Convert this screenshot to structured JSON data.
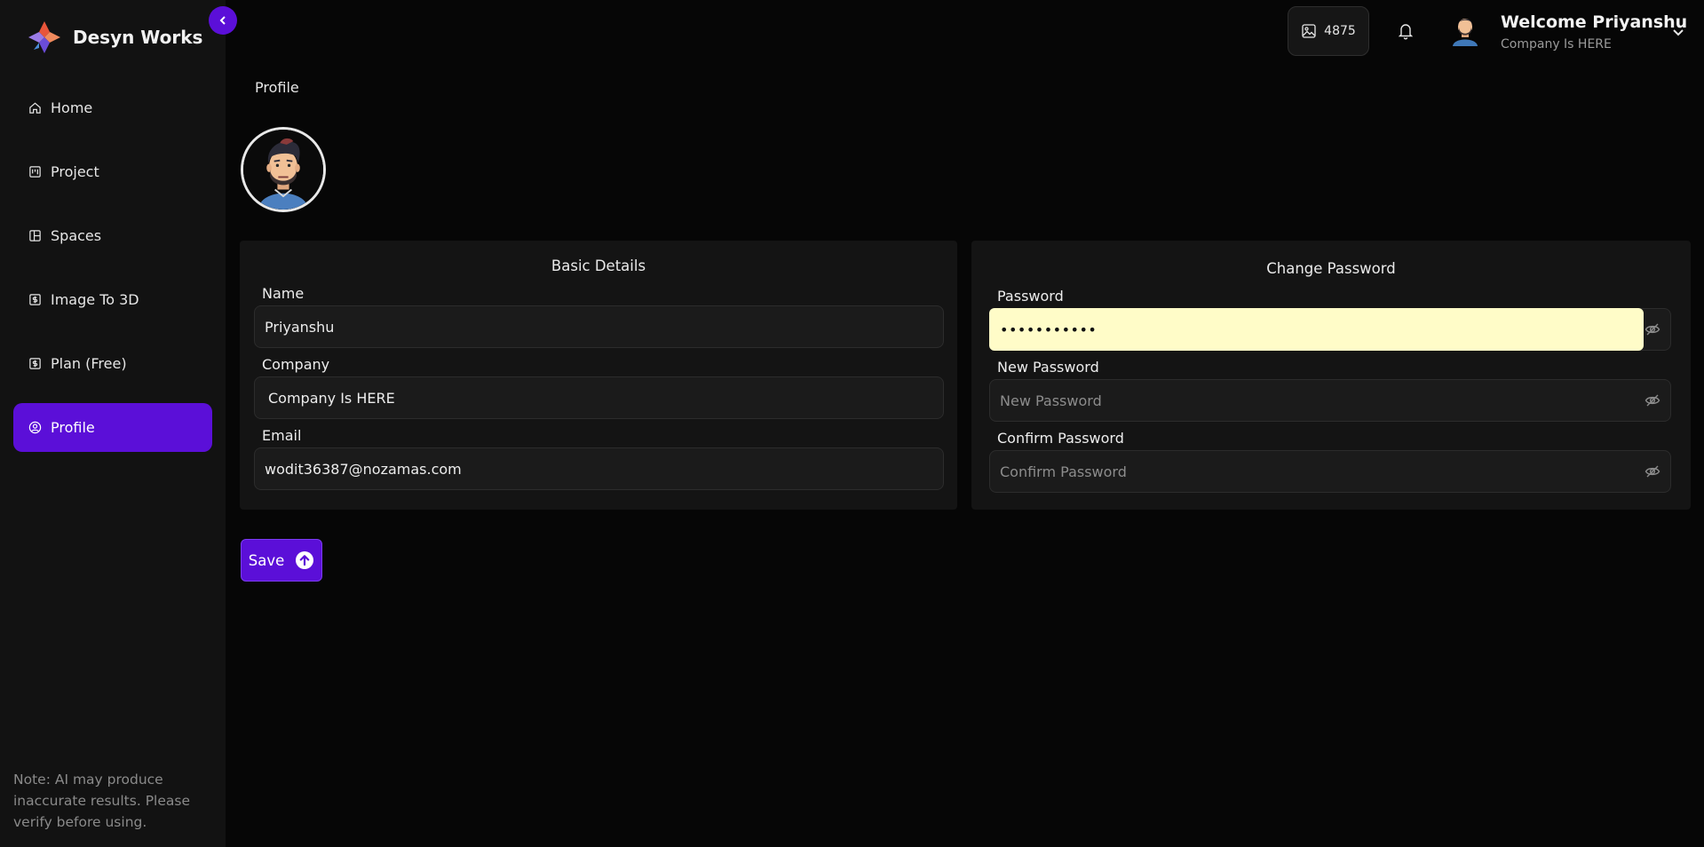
{
  "brand": {
    "name": "Desyn Works"
  },
  "sidebar": {
    "items": [
      {
        "label": "Home",
        "icon": "home-icon"
      },
      {
        "label": "Project",
        "icon": "project-icon"
      },
      {
        "label": "Spaces",
        "icon": "spaces-icon"
      },
      {
        "label": "Image To 3D",
        "icon": "dollar-box-icon"
      },
      {
        "label": "Plan (Free)",
        "icon": "dollar-box-icon"
      },
      {
        "label": "Profile",
        "icon": "user-circle-icon",
        "active": true
      }
    ],
    "note": "Note: AI may produce inaccurate results. Please verify before using."
  },
  "topbar": {
    "credits": "4875",
    "welcome": "Welcome Priyanshu",
    "company": "Company Is HERE"
  },
  "page": {
    "breadcrumb": "Profile"
  },
  "basic_details": {
    "title": "Basic Details",
    "name_label": "Name",
    "name_value": "Priyanshu",
    "company_label": "Company",
    "company_value": "Company Is HERE",
    "email_label": "Email",
    "email_value": "wodit36387@nozamas.com"
  },
  "change_password": {
    "title": "Change Password",
    "password_label": "Password",
    "password_value": "•••••••••••",
    "new_label": "New Password",
    "new_placeholder": "New Password",
    "confirm_label": "Confirm Password",
    "confirm_placeholder": "Confirm Password"
  },
  "actions": {
    "save_label": "Save"
  },
  "colors": {
    "accent": "#5b0fd8",
    "background": "#060606",
    "sidebar": "#121212",
    "card": "#141414",
    "autofill": "#fffcc8"
  }
}
